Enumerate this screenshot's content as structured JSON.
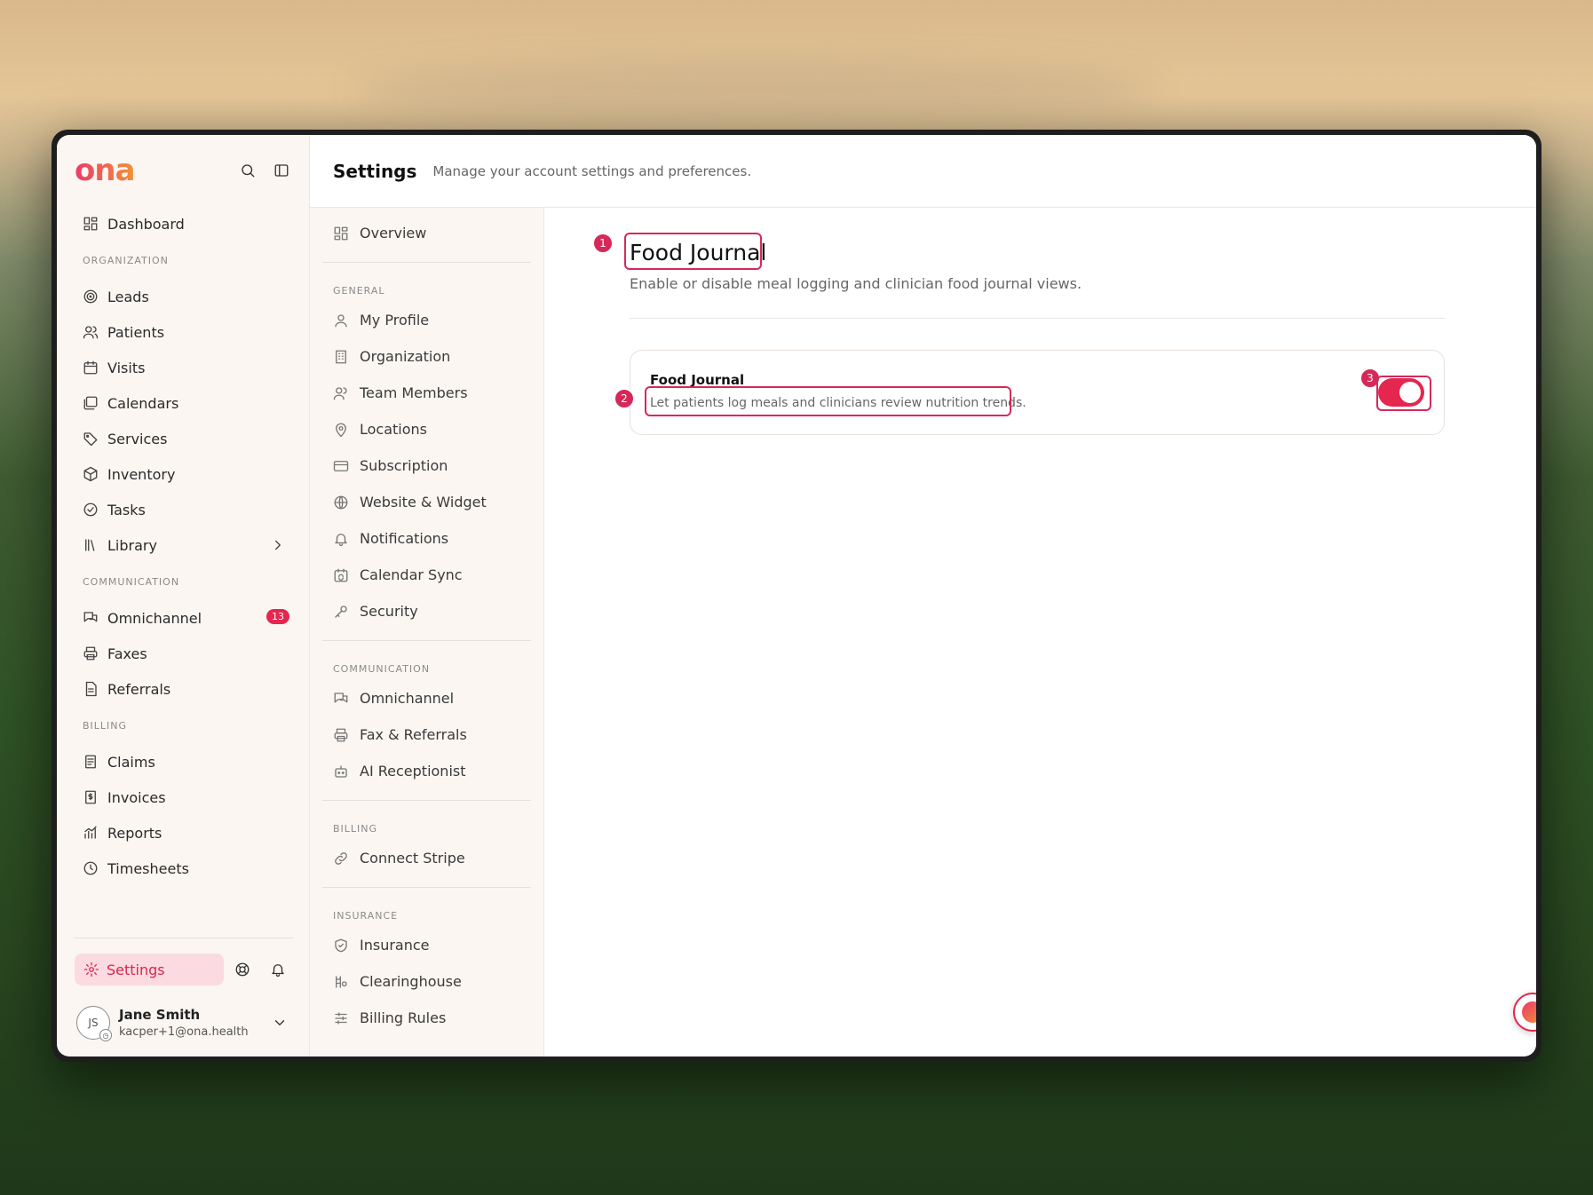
{
  "sidebar": {
    "logo": "ona",
    "items_top": [
      {
        "label": "Dashboard",
        "icon": "dashboard-icon"
      }
    ],
    "sections": [
      {
        "label": "ORGANIZATION",
        "items": [
          {
            "label": "Leads"
          },
          {
            "label": "Patients"
          },
          {
            "label": "Visits"
          },
          {
            "label": "Calendars"
          },
          {
            "label": "Services"
          },
          {
            "label": "Inventory"
          },
          {
            "label": "Tasks"
          },
          {
            "label": "Library"
          }
        ]
      },
      {
        "label": "COMMUNICATION",
        "items": [
          {
            "label": "Omnichannel",
            "badge": "13"
          },
          {
            "label": "Faxes"
          },
          {
            "label": "Referrals"
          }
        ]
      },
      {
        "label": "BILLING",
        "items": [
          {
            "label": "Claims"
          },
          {
            "label": "Invoices"
          },
          {
            "label": "Reports"
          },
          {
            "label": "Timesheets"
          }
        ]
      }
    ],
    "settings_label": "Settings",
    "user": {
      "initials": "JS",
      "name": "Jane Smith",
      "email": "kacper+1@ona.health"
    }
  },
  "header": {
    "title": "Settings",
    "subtitle": "Manage your account settings and preferences."
  },
  "subnav": {
    "overview": "Overview",
    "sections": [
      {
        "label": "GENERAL",
        "items": [
          "My Profile",
          "Organization",
          "Team Members",
          "Locations",
          "Subscription",
          "Website & Widget",
          "Notifications",
          "Calendar Sync",
          "Security"
        ]
      },
      {
        "label": "COMMUNICATION",
        "items": [
          "Omnichannel",
          "Fax & Referrals",
          "AI Receptionist"
        ]
      },
      {
        "label": "BILLING",
        "items": [
          "Connect Stripe"
        ]
      },
      {
        "label": "INSURANCE",
        "items": [
          "Insurance",
          "Clearinghouse",
          "Billing Rules"
        ]
      }
    ]
  },
  "content": {
    "title": "Food Journal",
    "description": "Enable or disable meal logging and clinician food journal views.",
    "card": {
      "title": "Food Journal",
      "description": "Let patients log meals and clinicians review nutrition trends.",
      "toggle_on": true
    },
    "markers": [
      "1",
      "2",
      "3"
    ]
  },
  "colors": {
    "accent": "#e5264f",
    "marker": "#d6295a"
  }
}
